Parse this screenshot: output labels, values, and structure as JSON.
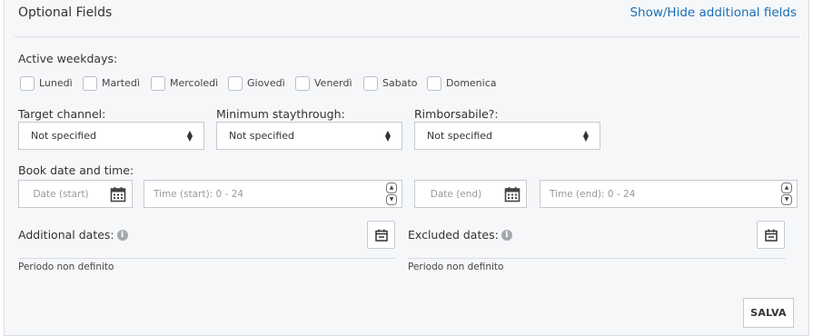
{
  "header": {
    "title": "Optional Fields",
    "toggle_link": "Show/Hide additional fields"
  },
  "weekdays": {
    "label": "Active weekdays:",
    "days": [
      {
        "label": "Lunedì",
        "checked": false
      },
      {
        "label": "Martedì",
        "checked": false
      },
      {
        "label": "Mercoledì",
        "checked": false
      },
      {
        "label": "Giovedì",
        "checked": false
      },
      {
        "label": "Venerdì",
        "checked": false
      },
      {
        "label": "Sabato",
        "checked": false
      },
      {
        "label": "Domenica",
        "checked": false
      }
    ]
  },
  "target_channel": {
    "label": "Target channel:",
    "value": "Not specified"
  },
  "min_staythrough": {
    "label": "Minimum staythrough:",
    "value": "Not specified"
  },
  "rimborsabile": {
    "label": "Rimborsabile?:",
    "value": "Not specified"
  },
  "book_date": {
    "label": "Book date and time:",
    "date_start_placeholder": "Date (start)",
    "time_start_placeholder": "Time (start): 0 - 24",
    "date_end_placeholder": "Date (end)",
    "time_end_placeholder": "Time (end): 0 - 24"
  },
  "additional_dates": {
    "label": "Additional dates:",
    "period_text": "Periodo non definito"
  },
  "excluded_dates": {
    "label": "Excluded dates:",
    "period_text": "Periodo non definito"
  },
  "save_label": "SALVA",
  "colors": {
    "link": "#1a6fb5",
    "panel_bg": "#f6f7f9",
    "border": "#c6cad0"
  },
  "icons": [
    "calendar-icon",
    "info-icon",
    "calendar-edit-icon",
    "select-arrows-icon",
    "spinner-up-icon",
    "spinner-down-icon"
  ]
}
